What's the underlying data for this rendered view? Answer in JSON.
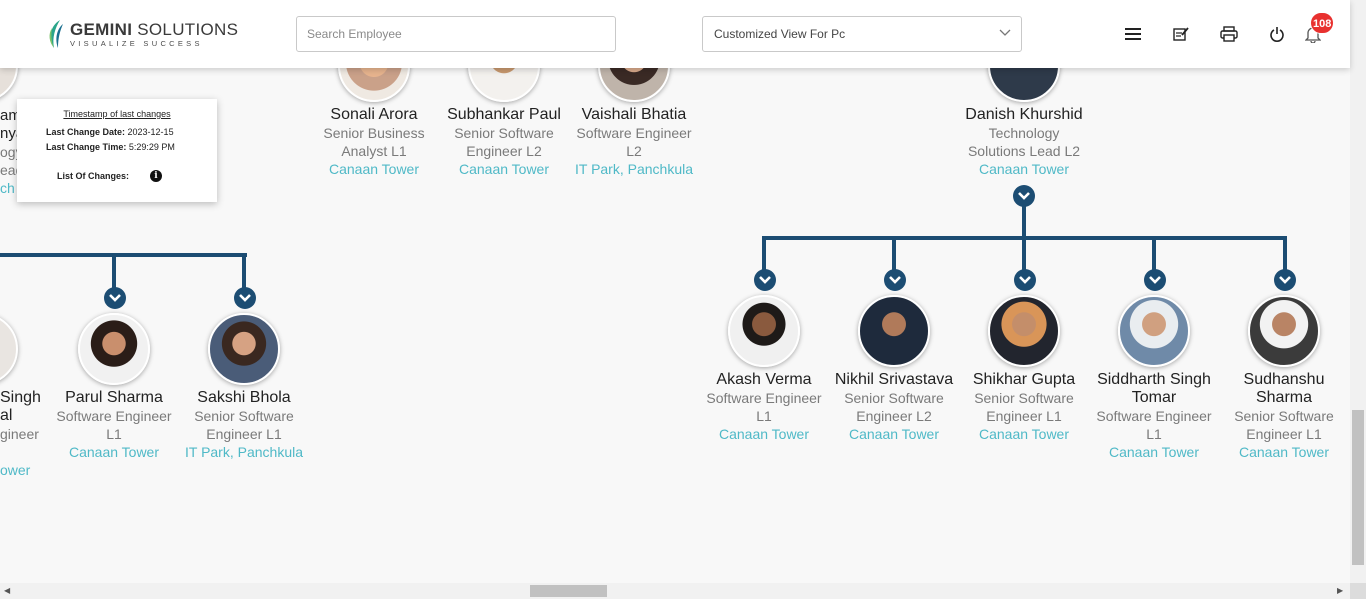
{
  "header": {
    "logo_name_bold": "GEMINI",
    "logo_name_rest": " SOLUTIONS",
    "logo_tagline": "VISUALIZE SUCCESS",
    "search_placeholder": "Search Employee",
    "view_select_value": "Customized View For Pc",
    "notification_count": "108",
    "icons": [
      "menu-icon",
      "edit-note-icon",
      "print-icon",
      "power-icon",
      "bell-icon"
    ]
  },
  "popup": {
    "title": "Timestamp of last changes",
    "date_label": "Last Change Date:",
    "date_value": "2023-12-15",
    "time_label": "Last Change Time:",
    "time_value": "5:29:29 PM",
    "changes_label": "List Of Changes:"
  },
  "partial_left_top": {
    "l1": "am",
    "l2": "nya",
    "l3": "ogy",
    "l4": "ead",
    "l5": "ch"
  },
  "top_row": [
    {
      "name": "Sonali Arora",
      "d1": "Senior Business",
      "d2": "Analyst L1",
      "loc": "Canaan Tower"
    },
    {
      "name": "Subhankar Paul",
      "d1": "Senior Software",
      "d2": "Engineer L2",
      "loc": "Canaan Tower"
    },
    {
      "name": "Vaishali Bhatia",
      "d1": "Software Engineer",
      "d2": "L2",
      "loc": "IT Park, Panchkula"
    },
    {
      "name": "Danish Khurshid",
      "d1": "Technology",
      "d2": "Solutions Lead L2",
      "loc": "Canaan Tower"
    }
  ],
  "left_children": [
    {
      "name": "Parul Sharma",
      "d1": "Software Engineer",
      "d2": "L1",
      "loc": "Canaan Tower"
    },
    {
      "name": "Sakshi Bhola",
      "d1": "Senior Software",
      "d2": "Engineer L1",
      "loc": "IT Park, Panchkula"
    }
  ],
  "partial_left_child": {
    "n1": "Singh",
    "n2": "al",
    "d1": "gineer",
    "loc": "ower"
  },
  "right_children": [
    {
      "name": "Akash Verma",
      "d1": "Software Engineer",
      "d2": "L1",
      "loc": "Canaan Tower"
    },
    {
      "name": "Nikhil Srivastava",
      "d1": "Senior Software",
      "d2": "Engineer L2",
      "loc": "Canaan Tower"
    },
    {
      "name": "Shikhar Gupta",
      "d1": "Senior Software",
      "d2": "Engineer L1",
      "loc": "Canaan Tower"
    },
    {
      "name": "Siddharth Singh",
      "name2": "Tomar",
      "d1": "Software Engineer",
      "d2": "L1",
      "loc": "Canaan Tower"
    },
    {
      "name": "Sudhanshu",
      "name2": "Sharma",
      "d1": "Senior Software",
      "d2": "Engineer L1",
      "loc": "Canaan Tower"
    }
  ],
  "colors": {
    "tree_line": "#1c4d73",
    "location": "#4fb9c7",
    "badge": "#e8312f"
  }
}
